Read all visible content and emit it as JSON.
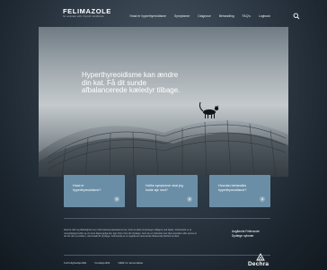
{
  "header": {
    "logo_text": "FELIMAZOLE",
    "logo_tagline": "for animals with thyroid conditions",
    "nav": [
      "Hvad er hyperthyreoidisme",
      "Symptomer",
      "Diagnose",
      "Behandling",
      "FAQ's",
      "Logbook"
    ]
  },
  "hero": {
    "headline": "Hyperthyreoidisme kan ændre din kat. Få dit sunde afbalancerede kæledyr tilbage."
  },
  "cards": [
    {
      "label": "Hvad er hyperthyreoidisme?"
    },
    {
      "label": "Hvilke symptomer skal jeg holde øje med?"
    },
    {
      "label": "Hvordan behandles hyperthyreoidisme?"
    }
  ],
  "footer": {
    "text": "Dechra står sig tilbørlighed over informationsmaterialerne her, fordi du altid vil dyrlægen tidligere ved hjælp. Felimazole er et receptpligtigt ledde og vil være tilgængeligt det, lige til kun hos din dyrlæge. Hvis du er mistroisk over hjemmesiden eller synes at du har det et problem, så kontakt dit dyrlæge. Felimazole er et registreret varemærke tilhørende Dechra Limited.",
    "right_links": [
      "Angående Felimazole",
      "Dyrlæge nyheder"
    ],
    "bottom_links": [
      "Fortrolighedspolitik",
      "Cookiepolitik",
      "Vilkår for anvendelse"
    ],
    "brand": "Dechra"
  },
  "colors": {
    "background": "#2e3a46",
    "card": "#6b8ea7"
  }
}
